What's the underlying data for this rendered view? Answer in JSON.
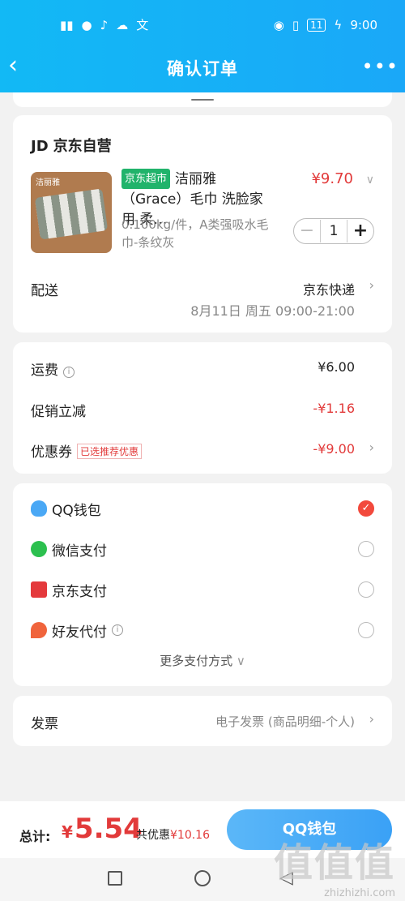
{
  "status": {
    "time": "9:00",
    "battery": "11",
    "left_icons": [
      "signal-icon",
      "wechat-icon",
      "music-icon",
      "weather-icon",
      "translate-icon"
    ],
    "right_icons": [
      "eye-icon",
      "vibrate-icon",
      "battery-icon",
      "charging-icon"
    ]
  },
  "header": {
    "title": "确认订单",
    "back_icon": "back-arrow-icon",
    "more_icon": "more-icon"
  },
  "shop": {
    "logo": "JD",
    "name": "京东自营"
  },
  "product": {
    "badge": "京东超市",
    "name": "洁丽雅（Grace）毛巾 洗脸家用 柔…",
    "spec": "0.100kg/件，A类强吸水毛巾-条纹灰",
    "price": "¥9.70",
    "quantity": "1",
    "thumb_brand": "洁丽雅"
  },
  "delivery": {
    "label": "配送",
    "method": "京东快递",
    "time": "8月11日 周五 09:00-21:00"
  },
  "fees": {
    "shipping_label": "运费",
    "shipping_value": "¥6.00",
    "promo_label": "促销立减",
    "promo_value": "-¥1.16",
    "coupon_label": "优惠券",
    "coupon_tag": "已选推荐优惠",
    "coupon_value": "-¥9.00"
  },
  "payment": {
    "options": [
      {
        "label": "QQ钱包",
        "icon": "qq-icon",
        "selected": true
      },
      {
        "label": "微信支付",
        "icon": "wechat-pay-icon",
        "selected": false
      },
      {
        "label": "京东支付",
        "icon": "jd-pay-icon",
        "selected": false
      },
      {
        "label": "好友代付",
        "icon": "friend-pay-icon",
        "selected": false
      }
    ],
    "more_label": "更多支付方式"
  },
  "invoice": {
    "label": "发票",
    "value": "电子发票 (商品明细-个人)"
  },
  "footer": {
    "total_label": "总计:",
    "currency": "¥",
    "total_amount": "5.54",
    "discount_label": "共优惠",
    "discount_value": "¥10.16",
    "pay_button": "QQ钱包"
  },
  "watermark": {
    "big": "值值值",
    "small": "zhizhizhi.com"
  },
  "colors": {
    "accent": "#12b9f5",
    "price_red": "#e23a3a",
    "pay_button": "#3aa1f6"
  }
}
